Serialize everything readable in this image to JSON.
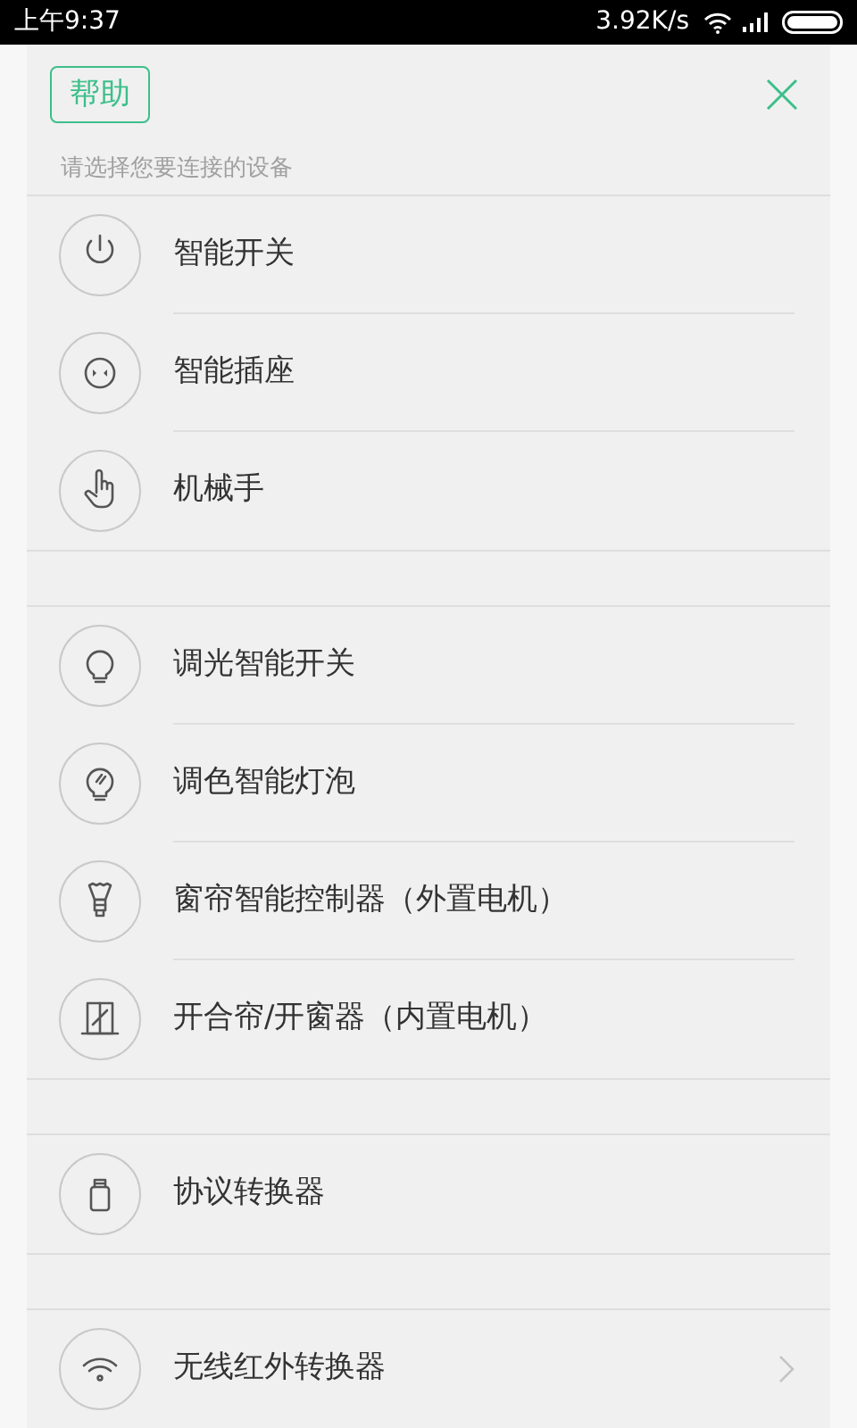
{
  "status_bar": {
    "time": "上午9:37",
    "speed": "3.92K/s"
  },
  "header": {
    "help_button": "帮助",
    "subtitle": "请选择您要连接的设备"
  },
  "groups": [
    {
      "items": [
        {
          "kind": "power",
          "label": "智能开关",
          "chevron": false
        },
        {
          "kind": "socket",
          "label": "智能插座",
          "chevron": false
        },
        {
          "kind": "hand",
          "label": "机械手",
          "chevron": false
        }
      ]
    },
    {
      "items": [
        {
          "kind": "bulb",
          "label": "调光智能开关",
          "chevron": false
        },
        {
          "kind": "color-bulb",
          "label": "调色智能灯泡",
          "chevron": false
        },
        {
          "kind": "curtain",
          "label": "窗帘智能控制器（外置电机）",
          "chevron": false
        },
        {
          "kind": "window",
          "label": "开合帘/开窗器（内置电机）",
          "chevron": false
        }
      ]
    },
    {
      "items": [
        {
          "kind": "dongle",
          "label": "协议转换器",
          "chevron": false
        }
      ]
    },
    {
      "items": [
        {
          "kind": "wifi",
          "label": "无线红外转换器",
          "chevron": true
        }
      ]
    }
  ]
}
